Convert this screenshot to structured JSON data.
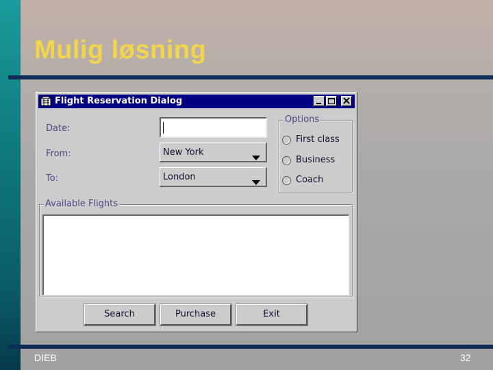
{
  "slide": {
    "title": "Mulig løsning",
    "footer_left": "DIEB",
    "page_number": "32"
  },
  "dialog": {
    "title": "Flight Reservation Dialog",
    "date_label": "Date:",
    "date_value": "",
    "from_label": "From:",
    "from_value": "New York",
    "to_label": "To:",
    "to_value": "London",
    "options": {
      "label": "Options",
      "items": [
        "First class",
        "Business",
        "Coach"
      ]
    },
    "flights": {
      "label": "Available Flights",
      "items": []
    },
    "buttons": {
      "search": "Search",
      "purchase": "Purchase",
      "exit": "Exit"
    }
  },
  "colors": {
    "title_yellow": "#f2d54a",
    "rule_navy": "#0f2b57",
    "titlebar_blue": "#000080",
    "dialog_gray": "#cccccc"
  },
  "icons": [
    "app-icon",
    "minimize-icon",
    "maximize-icon",
    "close-icon",
    "dropdown-arrow-icon"
  ]
}
